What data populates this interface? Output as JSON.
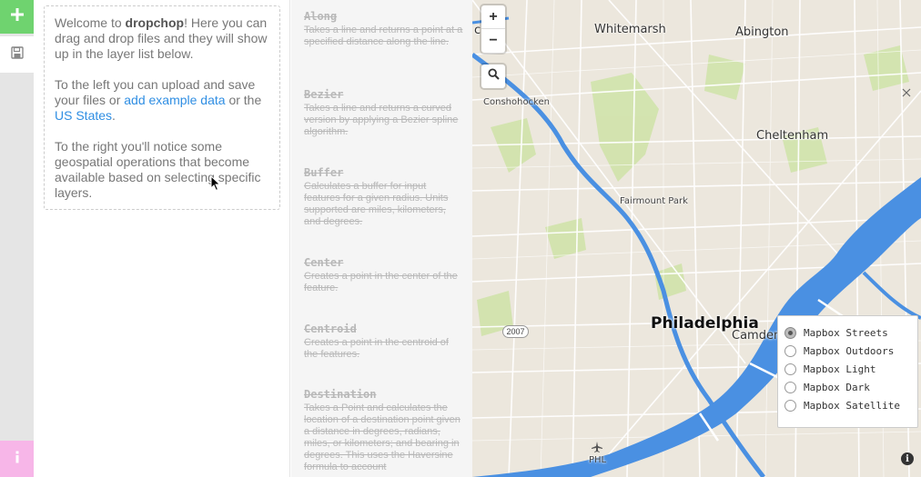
{
  "rail": {
    "add_icon": "plus-icon",
    "save_icon": "floppy-disk-icon",
    "info_icon": "info-icon",
    "add_color": "#6fd36f",
    "info_color": "#f7b6e8"
  },
  "welcome": {
    "p1_a": "Welcome to ",
    "p1_brand": "dropchop",
    "p1_b": "! Here you can drag and drop files and they will show up in the layer list below.",
    "p2_a": "To the left you can upload and save your files or ",
    "p2_link1": "add example data",
    "p2_b": " or the ",
    "p2_link2": "US States",
    "p2_c": ".",
    "p3": "To the right you'll notice some geospatial operations that become available based on selecting specific layers."
  },
  "operations": [
    {
      "name": "Along",
      "desc": "Takes a line and returns a point at a specified distance along the line."
    },
    {
      "name": "Bezier",
      "desc": "Takes a line and returns a curved version by applying a Bezier spline algorithm."
    },
    {
      "name": "Buffer",
      "desc": "Calculates a buffer for input features for a given radius. Units supported are miles, kilometers, and degrees."
    },
    {
      "name": "Center",
      "desc": "Creates a point in the center of the feature."
    },
    {
      "name": "Centroid",
      "desc": "Creates a point in the centroid of the features."
    },
    {
      "name": "Destination",
      "desc": "Takes a Point and calculates the location of a destination point given a distance in degrees, radians, miles, or kilometers; and bearing in degrees. This uses the Haversine formula to account"
    }
  ],
  "map": {
    "zoom_in": "+",
    "zoom_out": "−",
    "search_icon": "search-icon",
    "places": {
      "conshohocken": "Conshohocken",
      "whitemarsh": "Whitemarsh",
      "abington": "Abington",
      "cheltenham": "Cheltenham",
      "fairmount_park": "Fairmount Park",
      "philadelphia": "Philadelphia",
      "camden": "Camden",
      "phl": "PHL",
      "cut_left": "c"
    },
    "route_shield": "2007",
    "basemaps": [
      {
        "label": "Mapbox Streets",
        "selected": true
      },
      {
        "label": "Mapbox Outdoors",
        "selected": false
      },
      {
        "label": "Mapbox Light",
        "selected": false
      },
      {
        "label": "Mapbox Dark",
        "selected": false
      },
      {
        "label": "Mapbox Satellite",
        "selected": false
      }
    ],
    "attribution_icon": "i",
    "colors": {
      "land": "#ece7dd",
      "water": "#4a90e2",
      "park": "#cfe3a8",
      "road": "#ffffff"
    }
  }
}
